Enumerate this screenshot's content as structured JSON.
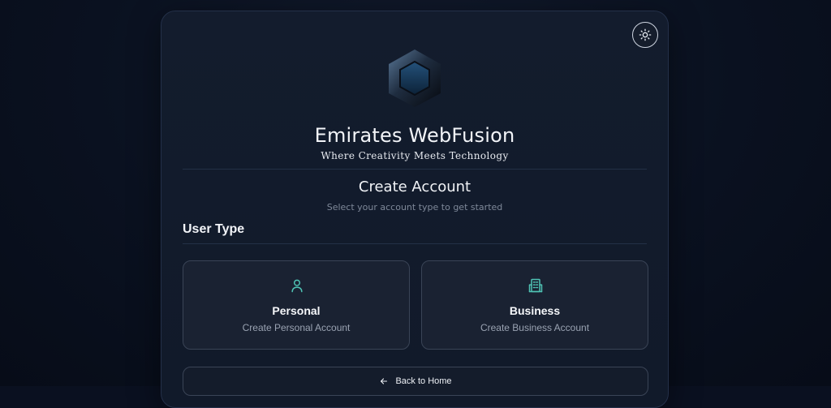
{
  "brand": {
    "title": "Emirates WebFusion",
    "tagline": "Where Creativity Meets Technology"
  },
  "form": {
    "heading": "Create Account",
    "subheading": "Select your account type to get started",
    "section_label": "User Type"
  },
  "account_types": [
    {
      "title": "Personal",
      "description": "Create Personal Account",
      "icon": "user-icon"
    },
    {
      "title": "Business",
      "description": "Create Business Account",
      "icon": "building-icon"
    }
  ],
  "back_button": {
    "label": "Back to Home",
    "icon": "arrow-left-icon"
  },
  "theme_toggle": {
    "icon": "sun-icon"
  },
  "colors": {
    "background": "#0a1020",
    "card": "#131c2d",
    "accent": "#4fc3b4",
    "text": "#f2f4f8",
    "muted": "#9aa3b2"
  }
}
